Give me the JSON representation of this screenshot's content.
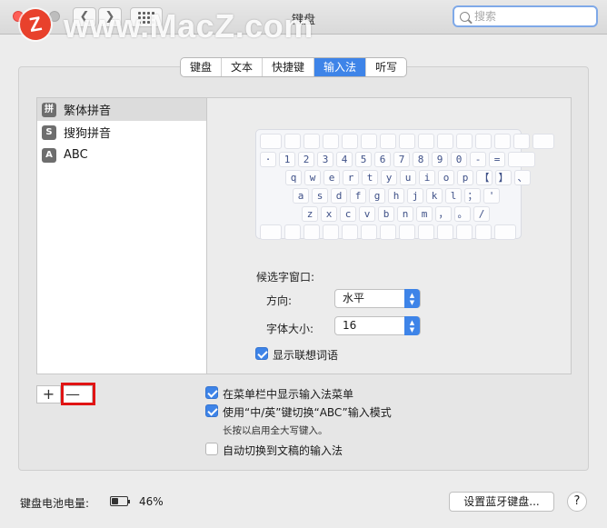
{
  "window": {
    "title": "键盘",
    "search_placeholder": "搜索"
  },
  "nav": {
    "back_glyph": "❮",
    "forward_glyph": "❯"
  },
  "watermark": {
    "logo": "Z",
    "text": "www.MacZ.com"
  },
  "tabs": [
    {
      "label": "键盘"
    },
    {
      "label": "文本"
    },
    {
      "label": "快捷键"
    },
    {
      "label": "输入法",
      "active": true
    },
    {
      "label": "听写"
    }
  ],
  "sources": [
    {
      "icon": "拼",
      "label": "繁体拼音",
      "selected": true
    },
    {
      "icon": "S",
      "label": "搜狗拼音"
    },
    {
      "icon": "A",
      "label": "ABC"
    }
  ],
  "keyboard": {
    "rows": [
      [
        "",
        "",
        "",
        "",
        "",
        "",
        "",
        "",
        "",
        "",
        "",
        "",
        "",
        "",
        ""
      ],
      [
        "·",
        "1",
        "2",
        "3",
        "4",
        "5",
        "6",
        "7",
        "8",
        "9",
        "0",
        "-",
        "=",
        ""
      ],
      [
        "q",
        "w",
        "e",
        "r",
        "t",
        "y",
        "u",
        "i",
        "o",
        "p",
        "【",
        "】",
        "、"
      ],
      [
        "a",
        "s",
        "d",
        "f",
        "g",
        "h",
        "j",
        "k",
        "l",
        "；",
        "'"
      ],
      [
        "z",
        "x",
        "c",
        "v",
        "b",
        "n",
        "m",
        "，",
        "。",
        "/"
      ],
      [
        "",
        "",
        "",
        "",
        "",
        "",
        "",
        "",
        "",
        "",
        "",
        "",
        ""
      ]
    ]
  },
  "candidate": {
    "heading": "候选字窗口:",
    "direction_label": "方向:",
    "direction_value": "水平",
    "font_size_label": "字体大小:",
    "font_size_value": "16",
    "show_assoc_label": "显示联想词语",
    "show_assoc_checked": true
  },
  "list_controls": {
    "add": "+",
    "remove": "—"
  },
  "options": {
    "show_menu_label": "在菜单栏中显示输入法菜单",
    "show_menu_checked": true,
    "switch_abc_label": "使用“中/英”键切换“ABC”输入模式",
    "switch_abc_checked": true,
    "switch_abc_note": "长按以启用全大写键入。",
    "auto_switch_label": "自动切换到文稿的输入法",
    "auto_switch_checked": false
  },
  "footer": {
    "battery_label": "键盘电池电量:",
    "battery_percent": "46%",
    "battery_level": 0.46,
    "bt_button": "设置蓝牙键盘...",
    "help": "?"
  },
  "colors": {
    "accent": "#3e84e8",
    "highlight": "#e01414"
  }
}
